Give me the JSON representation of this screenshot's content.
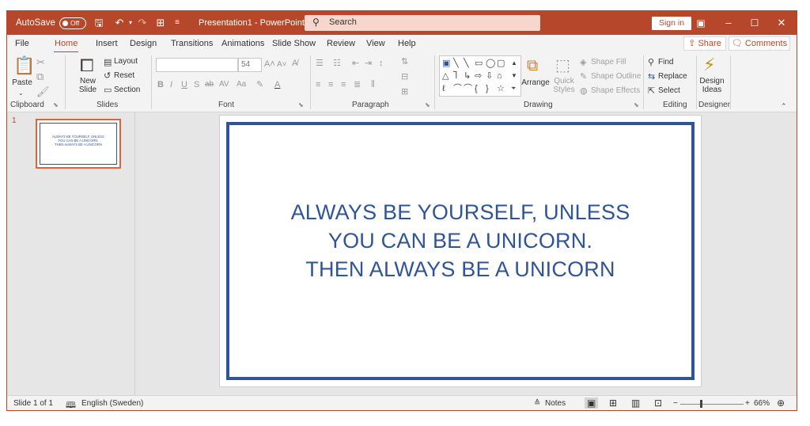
{
  "titlebar": {
    "autosave_label": "AutoSave",
    "autosave_state": "Off",
    "doc_title": "Presentation1  -  PowerPoint",
    "search_placeholder": "Search",
    "signin_label": "Sign in",
    "accent_color": "#b7472a"
  },
  "tabs": [
    "File",
    "Home",
    "Insert",
    "Design",
    "Transitions",
    "Animations",
    "Slide Show",
    "Review",
    "View",
    "Help"
  ],
  "active_tab": "Home",
  "share_label": "Share",
  "comments_label": "Comments",
  "ribbon": {
    "clipboard": {
      "paste": "Paste",
      "group": "Clipboard"
    },
    "slides": {
      "new_slide_line1": "New",
      "new_slide_line2": "Slide",
      "layout": "Layout",
      "reset": "Reset",
      "section": "Section",
      "group": "Slides"
    },
    "font": {
      "font_size": "54",
      "group": "Font"
    },
    "paragraph": {
      "group": "Paragraph"
    },
    "drawing": {
      "arrange": "Arrange",
      "quick_styles_1": "Quick",
      "quick_styles_2": "Styles",
      "shape_fill": "Shape Fill",
      "shape_outline": "Shape Outline",
      "shape_effects": "Shape Effects",
      "group": "Drawing"
    },
    "editing": {
      "find": "Find",
      "replace": "Replace",
      "select": "Select",
      "group": "Editing"
    },
    "designer": {
      "design_ideas_1": "Design",
      "design_ideas_2": "Ideas",
      "group": "Designer"
    }
  },
  "thumbnails": [
    {
      "number": "1",
      "lines": [
        "ALWAYS BE YOURSELF, UNLESS",
        "YOU CAN BE A UNICORN.",
        "THEN ALWAYS BE A UNICORN"
      ]
    }
  ],
  "slide": {
    "lines": [
      "ALWAYS BE YOURSELF, UNLESS",
      "YOU CAN BE A UNICORN.",
      "THEN ALWAYS BE A UNICORN"
    ],
    "text_color": "#2f5597",
    "border_color": "#2f5597"
  },
  "statusbar": {
    "slide_info": "Slide 1 of 1",
    "language": "English (Sweden)",
    "notes": "Notes",
    "zoom": "66%"
  }
}
